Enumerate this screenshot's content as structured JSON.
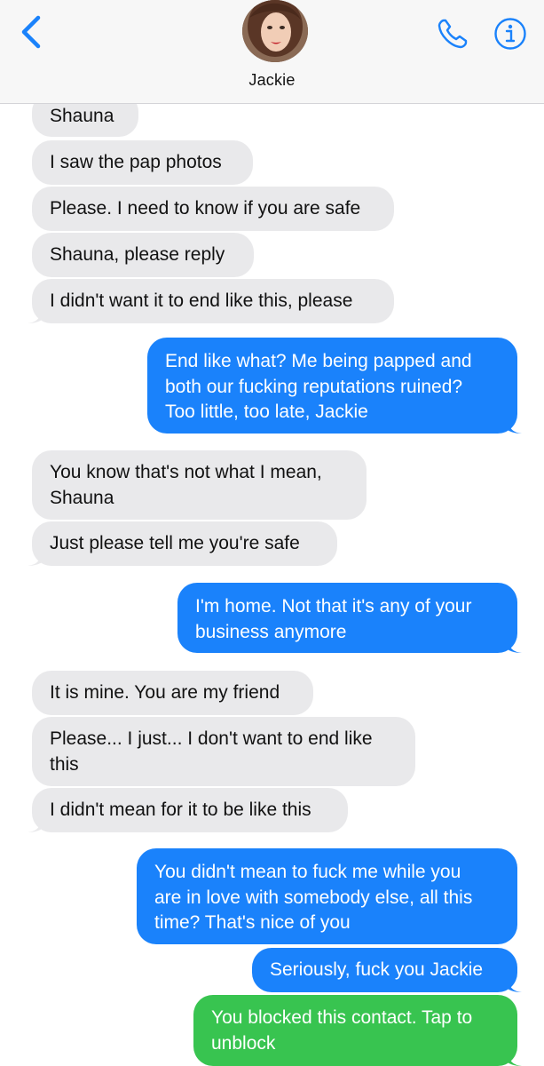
{
  "header": {
    "contact_name": "Jackie",
    "back_icon": "chevron-left-icon",
    "call_icon": "phone-icon",
    "info_icon": "info-icon",
    "accent_color": "#1a82fb"
  },
  "colors": {
    "incoming_bubble": "#e9e9eb",
    "outgoing_imessage": "#1a82fb",
    "outgoing_sms": "#38c450"
  },
  "messages": [
    {
      "direction": "incoming",
      "text": "Shauna"
    },
    {
      "direction": "incoming",
      "text": "I saw the pap photos"
    },
    {
      "direction": "incoming",
      "text": "Please. I need to know if you are safe"
    },
    {
      "direction": "incoming",
      "text": "Shauna, please reply"
    },
    {
      "direction": "incoming",
      "text": "I didn't want it to end like this, please"
    },
    {
      "direction": "outgoing",
      "lines": [
        "End like what? Me being papped and",
        "both our fucking reputations ruined?",
        "Too little, too late, Jackie"
      ]
    },
    {
      "direction": "incoming",
      "lines": [
        "You know that's not what I mean,",
        "Shauna"
      ]
    },
    {
      "direction": "incoming",
      "text": "Just please tell me you're safe"
    },
    {
      "direction": "outgoing",
      "lines": [
        "I'm home. Not that it's any of your",
        "business anymore"
      ]
    },
    {
      "direction": "incoming",
      "text": "It is mine. You are my friend"
    },
    {
      "direction": "incoming",
      "lines": [
        "Please... I just... I don't want to end like",
        "this"
      ]
    },
    {
      "direction": "incoming",
      "text": "I didn't mean for it to be like this"
    },
    {
      "direction": "outgoing",
      "lines": [
        "You didn't mean to fuck me while you",
        "are in love with somebody else, all this",
        "time? That's nice of you"
      ]
    },
    {
      "direction": "outgoing",
      "text": "Seriously, fuck you Jackie"
    },
    {
      "direction": "notice",
      "lines": [
        "You blocked this contact. Tap to",
        "unblock"
      ]
    }
  ]
}
